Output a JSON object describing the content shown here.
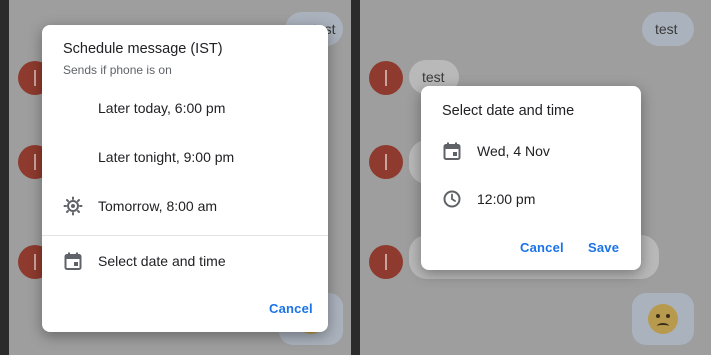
{
  "left": {
    "behind": {
      "bubble_text": "test"
    },
    "dialog": {
      "title": "Schedule message (IST)",
      "subtitle": "Sends if phone is on",
      "options": [
        {
          "label": "Later today, 6:00 pm",
          "icon": "moon-icon"
        },
        {
          "label": "Later tonight, 9:00 pm",
          "icon": "moon-icon"
        },
        {
          "label": "Tomorrow, 8:00 am",
          "icon": "sun-icon"
        },
        {
          "label": "Select date and time",
          "icon": "calendar-icon"
        }
      ],
      "cancel_label": "Cancel"
    }
  },
  "right": {
    "behind": {
      "bubble_out": "test",
      "bubble_in": "test",
      "emoji": "worried-face"
    },
    "dialog": {
      "title": "Select date and time",
      "date": "Wed, 4 Nov",
      "time": "12:00 pm",
      "cancel_label": "Cancel",
      "save_label": "Save"
    }
  },
  "colors": {
    "accent": "#1a73e8",
    "scrim": "#9e9e9e",
    "avatar": "#8f3a2e"
  }
}
